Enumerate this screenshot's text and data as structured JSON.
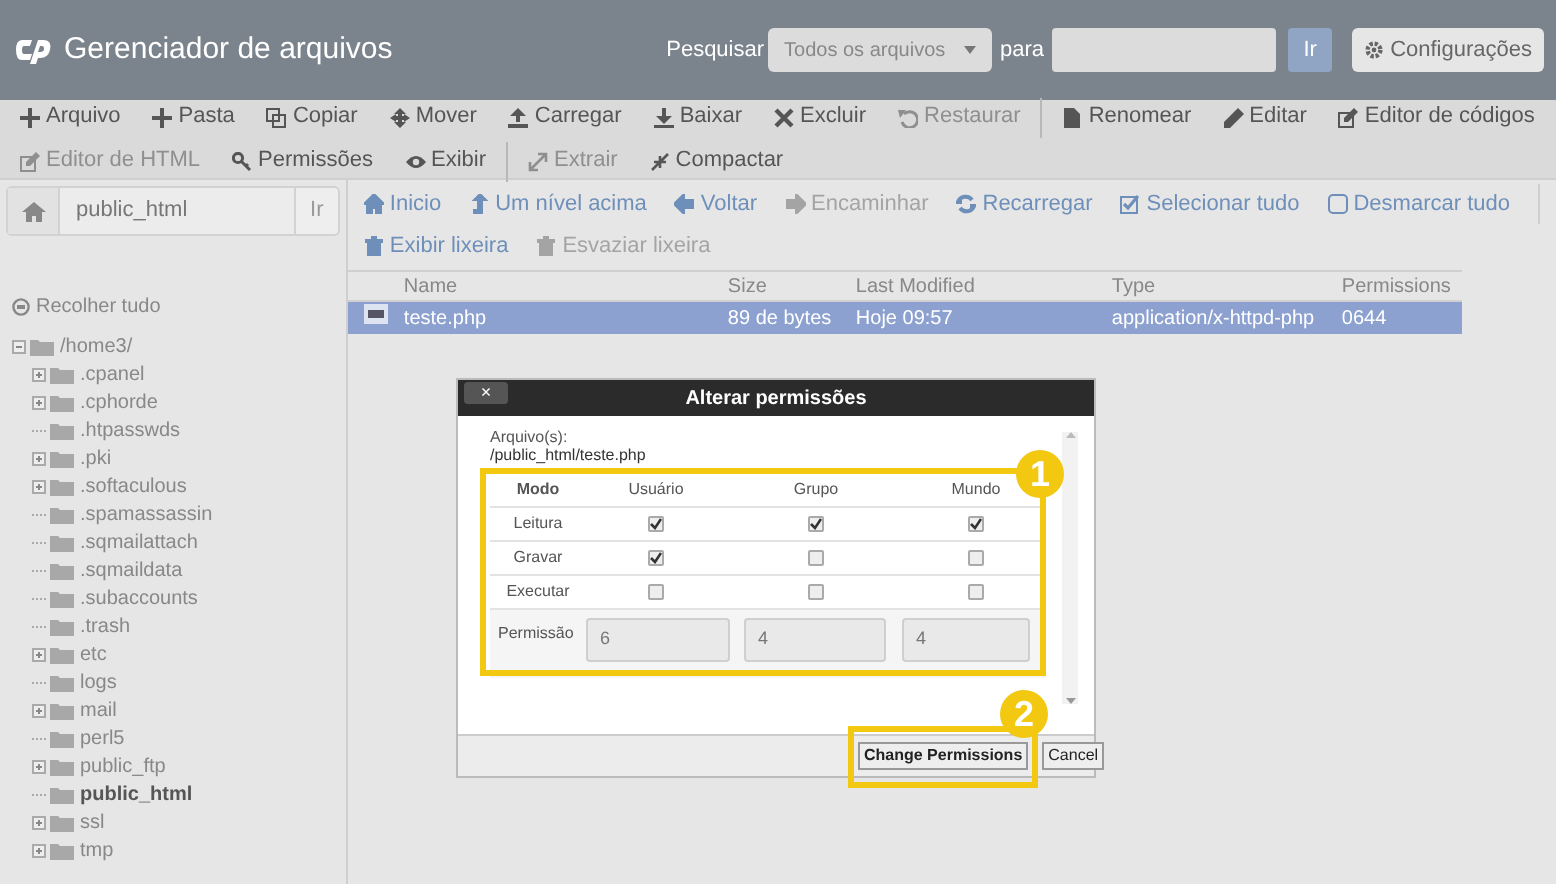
{
  "header": {
    "title": "Gerenciador de arquivos",
    "search_label": "Pesquisar",
    "search_scope": "Todos os arquivos",
    "for_label": "para",
    "go_button": "Ir",
    "settings_button": "Configurações"
  },
  "toolbar": {
    "primary": [
      {
        "label": "Arquivo",
        "disabled": false,
        "separator_before": false
      },
      {
        "label": "Pasta",
        "disabled": false,
        "separator_before": false
      },
      {
        "label": "Copiar",
        "disabled": false,
        "separator_before": false
      },
      {
        "label": "Mover",
        "disabled": false,
        "separator_before": false
      },
      {
        "label": "Carregar",
        "disabled": false,
        "separator_before": false
      },
      {
        "label": "Baixar",
        "disabled": false,
        "separator_before": false
      },
      {
        "label": "Excluir",
        "disabled": false,
        "separator_before": false
      },
      {
        "label": "Restaurar",
        "disabled": true,
        "separator_before": false
      },
      {
        "label": "Renomear",
        "disabled": false,
        "separator_before": true
      },
      {
        "label": "Editar",
        "disabled": false,
        "separator_before": false
      },
      {
        "label": "Editor de códigos",
        "disabled": false,
        "separator_before": false
      }
    ],
    "secondary": [
      {
        "label": "Editor de HTML",
        "disabled": true,
        "separator_before": false
      },
      {
        "label": "Permissões",
        "disabled": false,
        "separator_before": false
      },
      {
        "label": "Exibir",
        "disabled": false,
        "separator_before": false
      },
      {
        "label": "Extrair",
        "disabled": true,
        "separator_before": true
      },
      {
        "label": "Compactar",
        "disabled": false,
        "separator_before": false
      }
    ]
  },
  "sidebar": {
    "path_field": "public_html",
    "go_button": "Ir",
    "collapse_all": "Recolher tudo",
    "tree": [
      {
        "label": "/home3/",
        "expandable": true,
        "selected": false,
        "children": [
          {
            "label": ".cpanel",
            "expandable": true,
            "selected": false
          },
          {
            "label": ".cphorde",
            "expandable": true,
            "selected": false
          },
          {
            "label": ".htpasswds",
            "expandable": false,
            "selected": false
          },
          {
            "label": ".pki",
            "expandable": true,
            "selected": false
          },
          {
            "label": ".softaculous",
            "expandable": true,
            "selected": false
          },
          {
            "label": ".spamassassin",
            "expandable": false,
            "selected": false
          },
          {
            "label": ".sqmailattach",
            "expandable": false,
            "selected": false
          },
          {
            "label": ".sqmaildata",
            "expandable": false,
            "selected": false
          },
          {
            "label": ".subaccounts",
            "expandable": false,
            "selected": false
          },
          {
            "label": ".trash",
            "expandable": false,
            "selected": false
          },
          {
            "label": "etc",
            "expandable": true,
            "selected": false
          },
          {
            "label": "logs",
            "expandable": false,
            "selected": false
          },
          {
            "label": "mail",
            "expandable": true,
            "selected": false
          },
          {
            "label": "perl5",
            "expandable": false,
            "selected": false
          },
          {
            "label": "public_ftp",
            "expandable": true,
            "selected": false
          },
          {
            "label": "public_html",
            "expandable": false,
            "selected": true
          },
          {
            "label": "ssl",
            "expandable": true,
            "selected": false
          },
          {
            "label": "tmp",
            "expandable": true,
            "selected": false
          }
        ]
      }
    ]
  },
  "nav": {
    "primary": [
      {
        "label": "Inicio",
        "disabled": false
      },
      {
        "label": "Um nível acima",
        "disabled": false
      },
      {
        "label": "Voltar",
        "disabled": false
      },
      {
        "label": "Encaminhar",
        "disabled": true
      },
      {
        "label": "Recarregar",
        "disabled": false
      },
      {
        "label": "Selecionar tudo",
        "disabled": false
      },
      {
        "label": "Desmarcar tudo",
        "disabled": false
      }
    ],
    "secondary": [
      {
        "label": "Exibir lixeira",
        "disabled": false
      },
      {
        "label": "Esvaziar lixeira",
        "disabled": true
      }
    ]
  },
  "table": {
    "columns": [
      "Name",
      "Size",
      "Last Modified",
      "Type",
      "Permissions"
    ],
    "rows": [
      {
        "cells": [
          "teste.php",
          "89 de bytes",
          "Hoje 09:57",
          "application/x-httpd-php",
          "0644"
        ],
        "selected": true
      }
    ]
  },
  "dialog": {
    "close_button": "×",
    "title": "Alterar permissões",
    "file_label": "Arquivo(s):",
    "file_path": "/public_html/teste.php",
    "columns": [
      "Modo",
      "Usuário",
      "Grupo",
      "Mundo"
    ],
    "rows": [
      {
        "label": "Leitura",
        "checks": [
          true,
          true,
          true
        ]
      },
      {
        "label": "Gravar",
        "checks": [
          true,
          false,
          false
        ]
      },
      {
        "label": "Executar",
        "checks": [
          false,
          false,
          false
        ]
      }
    ],
    "permission_label": "Permissão",
    "permission_values": [
      "6",
      "4",
      "4"
    ],
    "buttons": [
      "Change Permissions",
      "Cancel"
    ]
  },
  "annotations": [
    {
      "label": "1"
    },
    {
      "label": "2"
    }
  ]
}
